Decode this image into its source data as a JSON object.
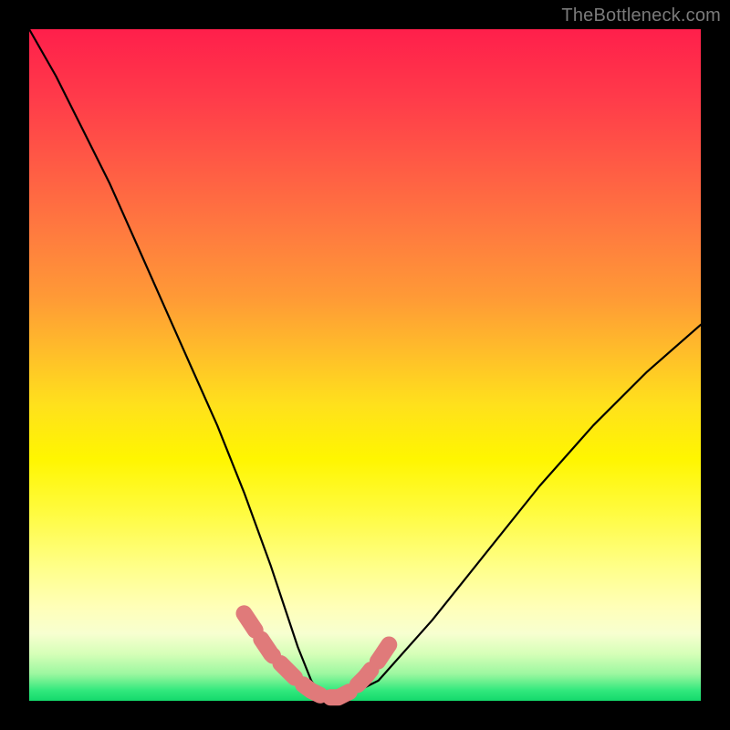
{
  "watermark": "TheBottleneck.com",
  "chart_data": {
    "type": "line",
    "title": "",
    "xlabel": "",
    "ylabel": "",
    "xlim": [
      0,
      100
    ],
    "ylim": [
      0,
      100
    ],
    "grid": false,
    "legend": false,
    "series": [
      {
        "name": "bottleneck-curve",
        "color": "#000000",
        "x": [
          0,
          4,
          8,
          12,
          16,
          20,
          24,
          28,
          32,
          36,
          38,
          40,
          42,
          44,
          46,
          52,
          60,
          68,
          76,
          84,
          92,
          100
        ],
        "y": [
          100,
          93,
          85,
          77,
          68,
          59,
          50,
          41,
          31,
          20,
          14,
          8,
          3,
          0,
          0,
          3,
          12,
          22,
          32,
          41,
          49,
          56
        ]
      },
      {
        "name": "highlight-band",
        "color": "#e07a7a",
        "x": [
          32,
          34,
          36,
          38,
          40,
          42,
          44,
          46,
          48,
          50,
          52,
          54
        ],
        "y": [
          13,
          10,
          7,
          5,
          3,
          1.5,
          0.5,
          0.5,
          1.5,
          3.5,
          6,
          9
        ]
      }
    ],
    "annotations": []
  },
  "colors": {
    "background": "#000000",
    "gradient_top": "#ff1f4b",
    "gradient_mid": "#fff600",
    "gradient_bottom": "#14d96c",
    "highlight": "#e07a7a",
    "watermark": "#7a7a7a"
  }
}
